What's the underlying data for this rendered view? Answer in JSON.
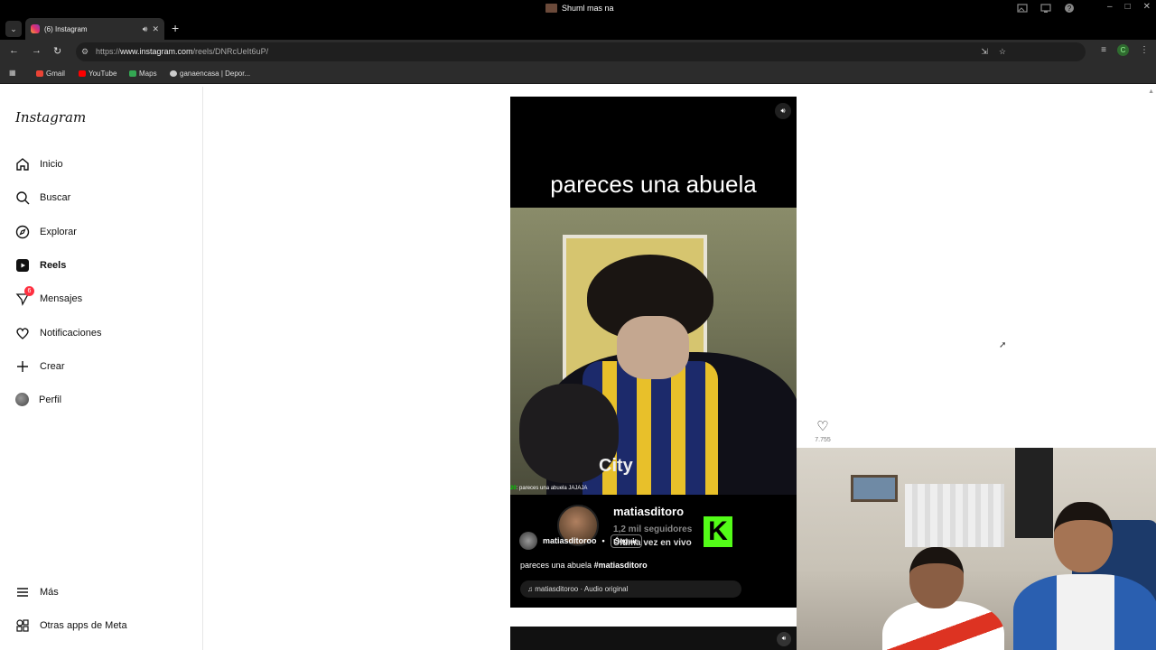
{
  "window": {
    "title": "Shuml mas na",
    "controls": [
      "–",
      "□",
      "✕"
    ]
  },
  "tabs": [
    {
      "label": "(6) Instagram",
      "active": true
    }
  ],
  "toolbar": {
    "url_prefix": "https://",
    "url_host": "www.instagram.com",
    "url_path": "/reels/DNRcUeIt6uP/",
    "profile_initial": "C"
  },
  "bookmarks": [
    {
      "label": "Gmail",
      "color": "#ea4335"
    },
    {
      "label": "YouTube",
      "color": "#ff0000"
    },
    {
      "label": "Maps",
      "color": "#34a853"
    },
    {
      "label": "ganaencasa | Depor...",
      "color": "#cccccc"
    }
  ],
  "sidebar": {
    "logo": "Instagram",
    "items": [
      {
        "label": "Inicio",
        "icon": "home-icon"
      },
      {
        "label": "Buscar",
        "icon": "search-icon"
      },
      {
        "label": "Explorar",
        "icon": "compass-icon"
      },
      {
        "label": "Reels",
        "icon": "reels-icon",
        "active": true
      },
      {
        "label": "Mensajes",
        "icon": "messages-icon",
        "badge": "6"
      },
      {
        "label": "Notificaciones",
        "icon": "heart-icon"
      },
      {
        "label": "Crear",
        "icon": "plus-icon"
      },
      {
        "label": "Perfil",
        "icon": "avatar"
      }
    ],
    "bottom": [
      {
        "label": "Más",
        "icon": "menu-icon"
      },
      {
        "label": "Otras apps de Meta",
        "icon": "apps-icon"
      }
    ]
  },
  "reel": {
    "top_caption": "pareces una abuela",
    "video_shirt_text": "City",
    "chat_line_user": "20",
    "chat_line_text": ": pareces una abuela JAJAJA",
    "overlay": {
      "name": "matiasditoro",
      "followers": "1,2 mil seguidores",
      "live": "Última vez en vivo"
    },
    "kick_logo": "K",
    "author": "matiasditoroo",
    "separator": "•",
    "follow_label": "Seguir",
    "description_text": "pareces una abuela ",
    "description_tag": "#matiasditoro",
    "audio": "matiasditoroo · Audio original",
    "like_count": "7.755"
  },
  "colors": {
    "kick_green": "#53fc18",
    "badge_red": "#ff3040",
    "chrome_bg": "#2c2c2c"
  }
}
